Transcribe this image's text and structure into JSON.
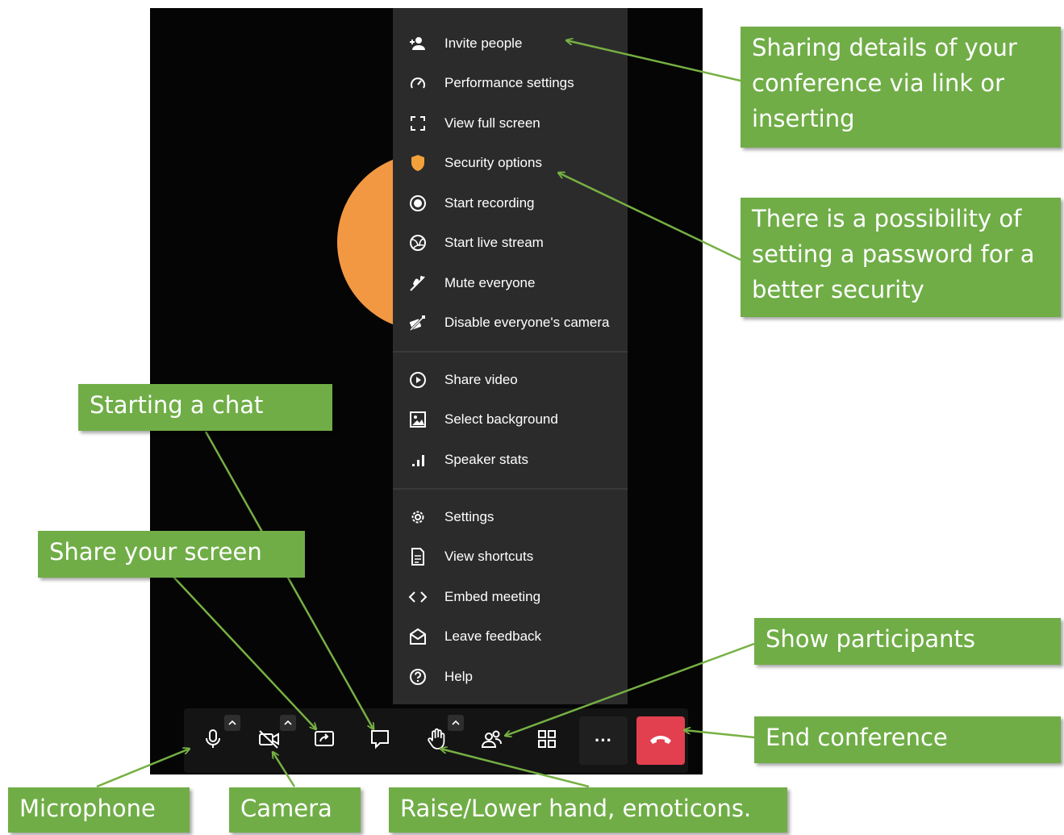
{
  "menu": {
    "items": [
      {
        "label": "Invite people",
        "icon": "invite-people-icon"
      },
      {
        "label": "Performance settings",
        "icon": "speedometer-icon"
      },
      {
        "label": "View full screen",
        "icon": "fullscreen-icon"
      },
      {
        "label": "Security options",
        "icon": "shield-icon"
      },
      {
        "label": "Start recording",
        "icon": "record-icon"
      },
      {
        "label": "Start live stream",
        "icon": "live-stream-icon"
      },
      {
        "label": "Mute everyone",
        "icon": "mute-everyone-icon"
      },
      {
        "label": "Disable everyone's camera",
        "icon": "camera-off-icon"
      },
      {
        "label": "Share video",
        "icon": "play-icon"
      },
      {
        "label": "Select background",
        "icon": "image-icon"
      },
      {
        "label": "Speaker stats",
        "icon": "stats-icon"
      },
      {
        "label": "Settings",
        "icon": "gear-icon"
      },
      {
        "label": "View shortcuts",
        "icon": "document-icon"
      },
      {
        "label": "Embed meeting",
        "icon": "code-icon"
      },
      {
        "label": "Leave feedback",
        "icon": "feedback-icon"
      },
      {
        "label": "Help",
        "icon": "help-icon"
      }
    ]
  },
  "toolbar": {
    "buttons": [
      "microphone-icon",
      "camera-off-icon",
      "share-screen-icon",
      "chat-icon",
      "raise-hand-icon",
      "participants-icon",
      "tile-view-icon",
      "more-icon",
      "hangup-icon"
    ],
    "more_label": "···"
  },
  "callouts": {
    "sharing": "Sharing details of your conference via link or inserting",
    "password": "There is a possibility of setting a password for a better security",
    "chat": "Starting a chat",
    "screen": "Share your screen",
    "participants": "Show participants",
    "end": "End conference",
    "microphone": "Microphone",
    "camera": "Camera",
    "hand": "Raise/Lower hand, emoticons."
  },
  "colors": {
    "callout_green": "#70ad47",
    "arrow_green": "#76b043",
    "hangup_red": "#e23f4f",
    "avatar_orange": "#f39842",
    "shield_orange": "#f3a13a",
    "menu_bg": "#2b2b2b"
  }
}
